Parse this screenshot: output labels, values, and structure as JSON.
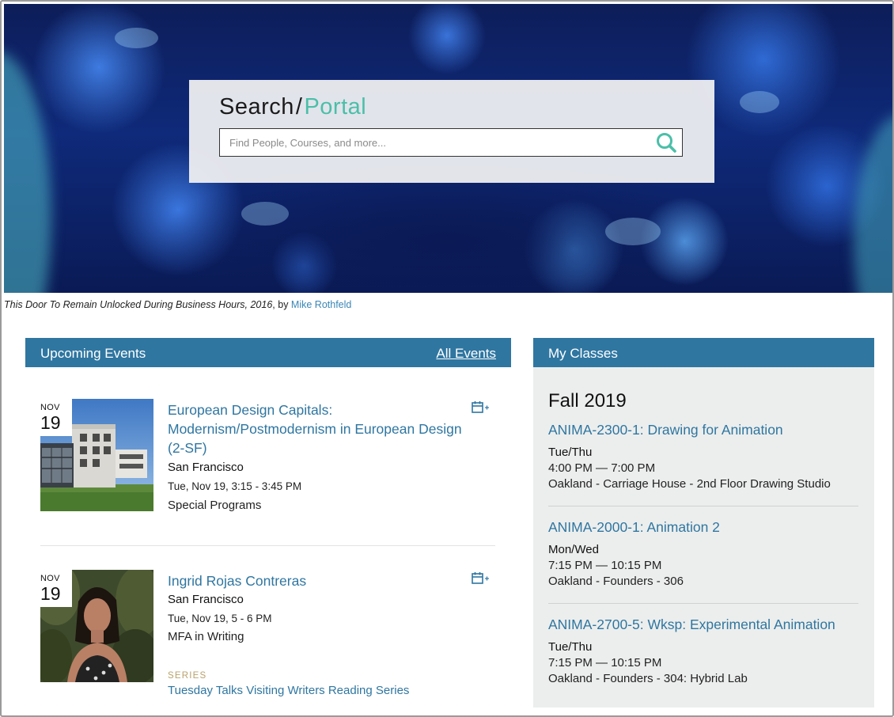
{
  "hero": {
    "search_title": "Search",
    "search_title_accent": "Portal",
    "search_placeholder": "Find People, Courses, and more...",
    "caption_title": "This Door To Remain Unlocked During Business Hours, 2016",
    "caption_by": ", by ",
    "caption_artist": "Mike Rothfeld"
  },
  "events": {
    "header": "Upcoming Events",
    "all_link": "All Events",
    "items": [
      {
        "month": "NOV",
        "day": "19",
        "title": "European Design Capitals: Modernism/Postmodernism in European Design (2-SF)",
        "location": "San Francisco",
        "time": "Tue, Nov 19, 3:15 - 3:45 PM",
        "category": "Special Programs"
      },
      {
        "month": "NOV",
        "day": "19",
        "title": "Ingrid Rojas Contreras",
        "location": "San Francisco",
        "time": "Tue, Nov 19, 5 - 6 PM",
        "category": "MFA in Writing",
        "series_label": "SERIES",
        "series": "Tuesday Talks Visiting Writers Reading Series"
      }
    ]
  },
  "classes": {
    "header": "My Classes",
    "term": "Fall 2019",
    "items": [
      {
        "name": "ANIMA-2300-1: Drawing for Animation",
        "days": "Tue/Thu",
        "time": "4:00 PM — 7:00 PM",
        "room": "Oakland - Carriage House - 2nd Floor Drawing Studio"
      },
      {
        "name": "ANIMA-2000-1: Animation 2",
        "days": "Mon/Wed",
        "time": "7:15 PM — 10:15 PM",
        "room": "Oakland - Founders - 306"
      },
      {
        "name": "ANIMA-2700-5: Wksp: Experimental Animation",
        "days": "Tue/Thu",
        "time": "7:15 PM — 10:15 PM",
        "room": "Oakland - Founders - 304: Hybrid Lab"
      }
    ]
  },
  "colors": {
    "accent_blue": "#2f76a1",
    "portal_teal": "#4bbfa8",
    "series_gold": "#b9a26c"
  }
}
